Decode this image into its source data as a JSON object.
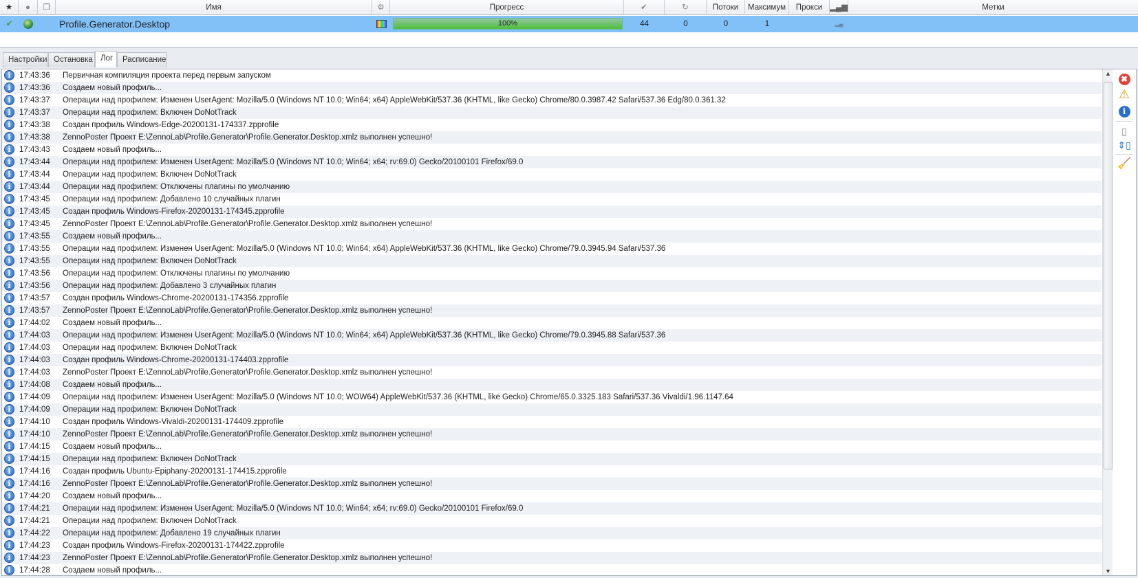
{
  "grid": {
    "headers": {
      "name": "Имя",
      "progress": "Прогресс",
      "threads": "Потоки",
      "maximum": "Максимум",
      "proxy": "Прокси",
      "tags": "Метки"
    },
    "row": {
      "name": "Profile.Generator.Desktop",
      "progress_label": "100%",
      "progress": 100,
      "done": "44",
      "retries": "0",
      "threads": "0",
      "maximum": "1",
      "proxy": "",
      "tags": ""
    }
  },
  "tabs": [
    "Настройки",
    "Остановка",
    "Лог",
    "Расписание"
  ],
  "active_tab": "Лог",
  "log": [
    [
      "17:43:36",
      "Первичная компиляция проекта перед первым запуском"
    ],
    [
      "17:43:36",
      "Создаем новый профиль..."
    ],
    [
      "17:43:37",
      "Операции над профилем: Изменен UserAgent: Mozilla/5.0 (Windows NT 10.0; Win64; x64) AppleWebKit/537.36 (KHTML, like Gecko) Chrome/80.0.3987.42 Safari/537.36 Edg/80.0.361.32"
    ],
    [
      "17:43:37",
      "Операции над профилем: Включен DoNotTrack"
    ],
    [
      "17:43:38",
      "Создан профиль Windows-Edge-20200131-174337.zpprofile"
    ],
    [
      "17:43:38",
      "ZennoPoster Проект E:\\ZennoLab\\Profile.Generator\\Profile.Generator.Desktop.xmlz выполнен успешно!"
    ],
    [
      "17:43:43",
      "Создаем новый профиль..."
    ],
    [
      "17:43:44",
      "Операции над профилем: Изменен UserAgent: Mozilla/5.0 (Windows NT 10.0; Win64; x64; rv:69.0) Gecko/20100101 Firefox/69.0"
    ],
    [
      "17:43:44",
      "Операции над профилем: Включен DoNotTrack"
    ],
    [
      "17:43:44",
      "Операции над профилем: Отключены плагины по умолчанию"
    ],
    [
      "17:43:45",
      "Операции над профилем: Добавлено 10 случайных плагин"
    ],
    [
      "17:43:45",
      "Создан профиль Windows-Firefox-20200131-174345.zpprofile"
    ],
    [
      "17:43:45",
      "ZennoPoster Проект E:\\ZennoLab\\Profile.Generator\\Profile.Generator.Desktop.xmlz выполнен успешно!"
    ],
    [
      "17:43:55",
      "Создаем новый профиль..."
    ],
    [
      "17:43:55",
      "Операции над профилем: Изменен UserAgent: Mozilla/5.0 (Windows NT 10.0; Win64; x64) AppleWebKit/537.36 (KHTML, like Gecko) Chrome/79.0.3945.94 Safari/537.36"
    ],
    [
      "17:43:55",
      "Операции над профилем: Включен DoNotTrack"
    ],
    [
      "17:43:56",
      "Операции над профилем: Отключены плагины по умолчанию"
    ],
    [
      "17:43:56",
      "Операции над профилем: Добавлено 3 случайных плагин"
    ],
    [
      "17:43:57",
      "Создан профиль Windows-Chrome-20200131-174356.zpprofile"
    ],
    [
      "17:43:57",
      "ZennoPoster Проект E:\\ZennoLab\\Profile.Generator\\Profile.Generator.Desktop.xmlz выполнен успешно!"
    ],
    [
      "17:44:02",
      "Создаем новый профиль..."
    ],
    [
      "17:44:03",
      "Операции над профилем: Изменен UserAgent: Mozilla/5.0 (Windows NT 10.0; Win64; x64) AppleWebKit/537.36 (KHTML, like Gecko) Chrome/79.0.3945.88 Safari/537.36"
    ],
    [
      "17:44:03",
      "Операции над профилем: Включен DoNotTrack"
    ],
    [
      "17:44:03",
      "Создан профиль Windows-Chrome-20200131-174403.zpprofile"
    ],
    [
      "17:44:03",
      "ZennoPoster Проект E:\\ZennoLab\\Profile.Generator\\Profile.Generator.Desktop.xmlz выполнен успешно!"
    ],
    [
      "17:44:08",
      "Создаем новый профиль..."
    ],
    [
      "17:44:09",
      "Операции над профилем: Изменен UserAgent: Mozilla/5.0 (Windows NT 10.0; WOW64) AppleWebKit/537.36 (KHTML, like Gecko) Chrome/65.0.3325.183 Safari/537.36 Vivaldi/1.96.1147.64"
    ],
    [
      "17:44:09",
      "Операции над профилем: Включен DoNotTrack"
    ],
    [
      "17:44:10",
      "Создан профиль Windows-Vivaldi-20200131-174409.zpprofile"
    ],
    [
      "17:44:10",
      "ZennoPoster Проект E:\\ZennoLab\\Profile.Generator\\Profile.Generator.Desktop.xmlz выполнен успешно!"
    ],
    [
      "17:44:15",
      "Создаем новый профиль..."
    ],
    [
      "17:44:15",
      "Операции над профилем: Включен DoNotTrack"
    ],
    [
      "17:44:16",
      "Создан профиль Ubuntu-Epiphany-20200131-174415.zpprofile"
    ],
    [
      "17:44:16",
      "ZennoPoster Проект E:\\ZennoLab\\Profile.Generator\\Profile.Generator.Desktop.xmlz выполнен успешно!"
    ],
    [
      "17:44:20",
      "Создаем новый профиль..."
    ],
    [
      "17:44:21",
      "Операции над профилем: Изменен UserAgent: Mozilla/5.0 (Windows NT 10.0; Win64; x64; rv:69.0) Gecko/20100101 Firefox/69.0"
    ],
    [
      "17:44:21",
      "Операции над профилем: Включен DoNotTrack"
    ],
    [
      "17:44:22",
      "Операции над профилем: Добавлено 19 случайных плагин"
    ],
    [
      "17:44:23",
      "Создан профиль Windows-Firefox-20200131-174422.zpprofile"
    ],
    [
      "17:44:23",
      "ZennoPoster Проект E:\\ZennoLab\\Profile.Generator\\Profile.Generator.Desktop.xmlz выполнен успешно!"
    ],
    [
      "17:44:28",
      "Создаем новый профиль..."
    ]
  ],
  "icons": {
    "log_row": "info-icon",
    "side": [
      "error-filter-icon",
      "warning-filter-icon",
      "info-filter-icon",
      "autoscroll-icon",
      "fit-columns-icon",
      "clear-log-icon"
    ]
  },
  "colors": {
    "selected_row": "#82c0f8",
    "progress": "#4fbf3a"
  }
}
